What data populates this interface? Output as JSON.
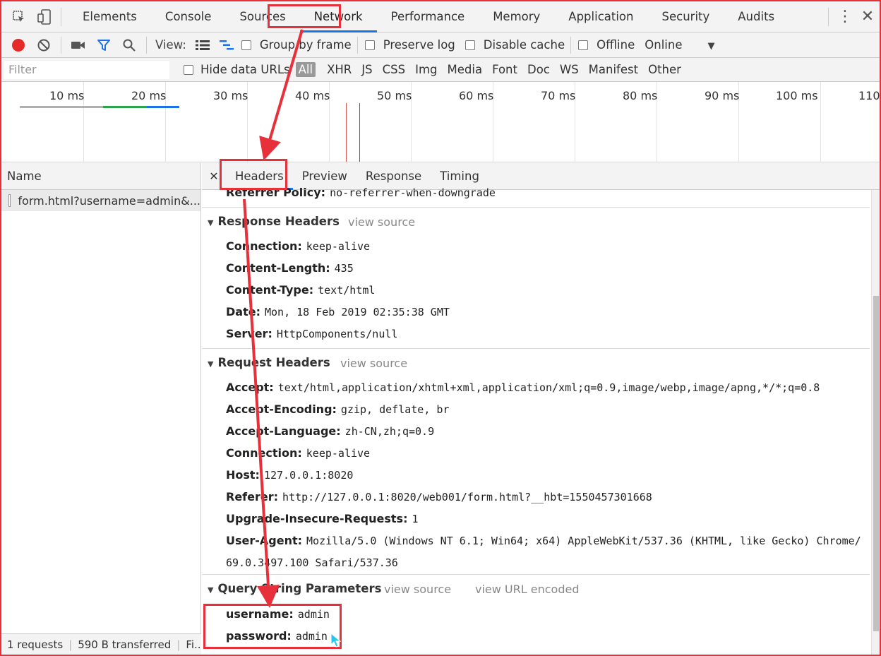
{
  "main_tabs": [
    {
      "label": "Elements"
    },
    {
      "label": "Console"
    },
    {
      "label": "Sources"
    },
    {
      "label": "Network",
      "active": true
    },
    {
      "label": "Performance"
    },
    {
      "label": "Memory"
    },
    {
      "label": "Application"
    },
    {
      "label": "Security"
    },
    {
      "label": "Audits"
    }
  ],
  "toolbar": {
    "view_label": "View:",
    "group_by_frame": "Group by frame",
    "preserve_log": "Preserve log",
    "disable_cache": "Disable cache",
    "offline": "Offline",
    "throttling": "Online"
  },
  "filter": {
    "placeholder": "Filter",
    "hide_data_urls": "Hide data URLs",
    "types": [
      "All",
      "XHR",
      "JS",
      "CSS",
      "Img",
      "Media",
      "Font",
      "Doc",
      "WS",
      "Manifest",
      "Other"
    ],
    "active_type": "All"
  },
  "timeline": {
    "ticks": [
      "10 ms",
      "20 ms",
      "30 ms",
      "40 ms",
      "50 ms",
      "60 ms",
      "70 ms",
      "80 ms",
      "90 ms",
      "100 ms",
      "110"
    ]
  },
  "name_pane": {
    "header": "Name",
    "rows": [
      "form.html?username=admin&..."
    ],
    "status": {
      "requests": "1 requests",
      "transferred": "590 B transferred",
      "finish": "Fi..."
    }
  },
  "detail": {
    "tabs": [
      "Headers",
      "Preview",
      "Response",
      "Timing"
    ],
    "active_tab": "Headers",
    "partial_row": {
      "name": "Referrer Policy:",
      "value": "no-referrer-when-downgrade"
    },
    "response_headers": {
      "title": "Response Headers",
      "view_source": "view source",
      "items": [
        {
          "name": "Connection:",
          "value": "keep-alive"
        },
        {
          "name": "Content-Length:",
          "value": "435"
        },
        {
          "name": "Content-Type:",
          "value": "text/html"
        },
        {
          "name": "Date:",
          "value": "Mon, 18 Feb 2019 02:35:38 GMT"
        },
        {
          "name": "Server:",
          "value": "HttpComponents/null"
        }
      ]
    },
    "request_headers": {
      "title": "Request Headers",
      "view_source": "view source",
      "items": [
        {
          "name": "Accept:",
          "value": "text/html,application/xhtml+xml,application/xml;q=0.9,image/webp,image/apng,*/*;q=0.8"
        },
        {
          "name": "Accept-Encoding:",
          "value": "gzip, deflate, br"
        },
        {
          "name": "Accept-Language:",
          "value": "zh-CN,zh;q=0.9"
        },
        {
          "name": "Connection:",
          "value": "keep-alive"
        },
        {
          "name": "Host:",
          "value": "127.0.0.1:8020"
        },
        {
          "name": "Referer:",
          "value": "http://127.0.0.1:8020/web001/form.html?__hbt=1550457301668"
        },
        {
          "name": "Upgrade-Insecure-Requests:",
          "value": "1"
        },
        {
          "name": "User-Agent:",
          "value": "Mozilla/5.0 (Windows NT 6.1; Win64; x64) AppleWebKit/537.36 (KHTML, like Gecko) Chrome/"
        },
        {
          "name": "",
          "value": "69.0.3497.100 Safari/537.36"
        }
      ]
    },
    "query_params": {
      "title": "Query String Parameters",
      "view_source": "view source",
      "view_url_encoded": "view URL encoded",
      "items": [
        {
          "name": "username:",
          "value": "admin"
        },
        {
          "name": "password:",
          "value": "admin"
        }
      ]
    }
  },
  "colors": {
    "annotation": "#e8303a",
    "active_tab_underline": "#1a73e8",
    "record": "#e62a2a",
    "filter_icon": "#1a73e8"
  }
}
